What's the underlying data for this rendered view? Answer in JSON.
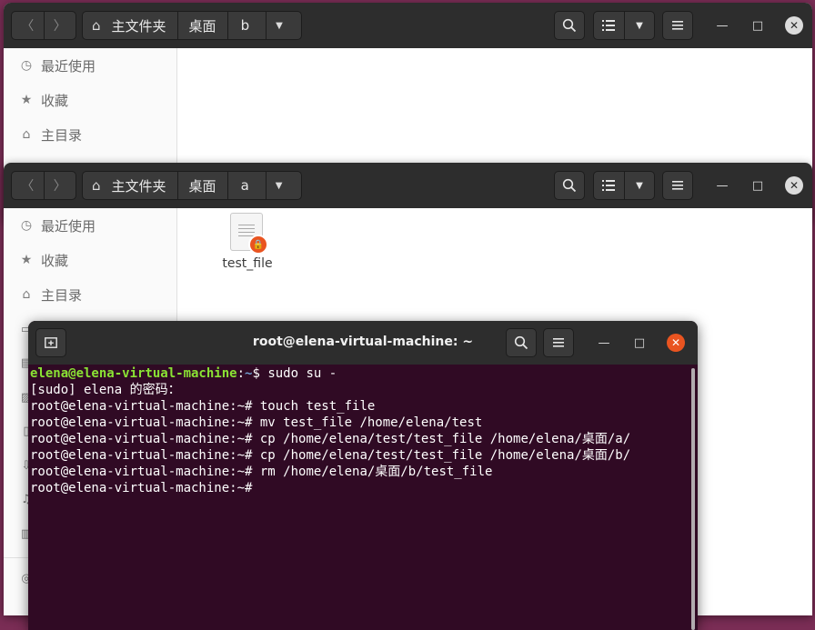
{
  "window_back": {
    "breadcrumb": {
      "home": "主文件夹",
      "desktop": "桌面",
      "current": "b"
    },
    "sidebar": [
      {
        "icon": "clock-icon",
        "label": "最近使用"
      },
      {
        "icon": "star-icon",
        "label": "收藏"
      },
      {
        "icon": "home-icon",
        "label": "主目录"
      }
    ]
  },
  "window_front": {
    "breadcrumb": {
      "home": "主文件夹",
      "desktop": "桌面",
      "current": "a"
    },
    "sidebar": [
      {
        "icon": "clock-icon",
        "label": "最近使用"
      },
      {
        "icon": "star-icon",
        "label": "收藏"
      },
      {
        "icon": "home-icon",
        "label": "主目录"
      }
    ],
    "files": [
      {
        "name": "test_file",
        "icon": "text-document-icon",
        "badge": "lock-icon"
      }
    ]
  },
  "terminal": {
    "title": "root@elena-virtual-machine: ~",
    "lines": [
      {
        "user": "elena@elena-virtual-machine",
        "sep": ":",
        "path": "~",
        "prompt": "$ ",
        "cmd": "sudo su -"
      },
      {
        "text": "[sudo] elena 的密码："
      },
      {
        "prompt": "root@elena-virtual-machine:~# ",
        "cmd": "touch test_file"
      },
      {
        "prompt": "root@elena-virtual-machine:~# ",
        "cmd": "mv test_file /home/elena/test"
      },
      {
        "prompt": "root@elena-virtual-machine:~# ",
        "cmd": "cp /home/elena/test/test_file /home/elena/桌面/a/"
      },
      {
        "prompt": "root@elena-virtual-machine:~# ",
        "cmd": "cp /home/elena/test/test_file /home/elena/桌面/b/"
      },
      {
        "prompt": "root@elena-virtual-machine:~# ",
        "cmd": "rm /home/elena/桌面/b/test_file"
      },
      {
        "prompt": "root@elena-virtual-machine:~# ",
        "cmd": ""
      }
    ]
  },
  "colors": {
    "accent": "#e95420",
    "terminal_bg": "#300a24",
    "prompt_user": "#8ae234",
    "prompt_path": "#729fcf",
    "headerbar": "#2d2d2d"
  }
}
